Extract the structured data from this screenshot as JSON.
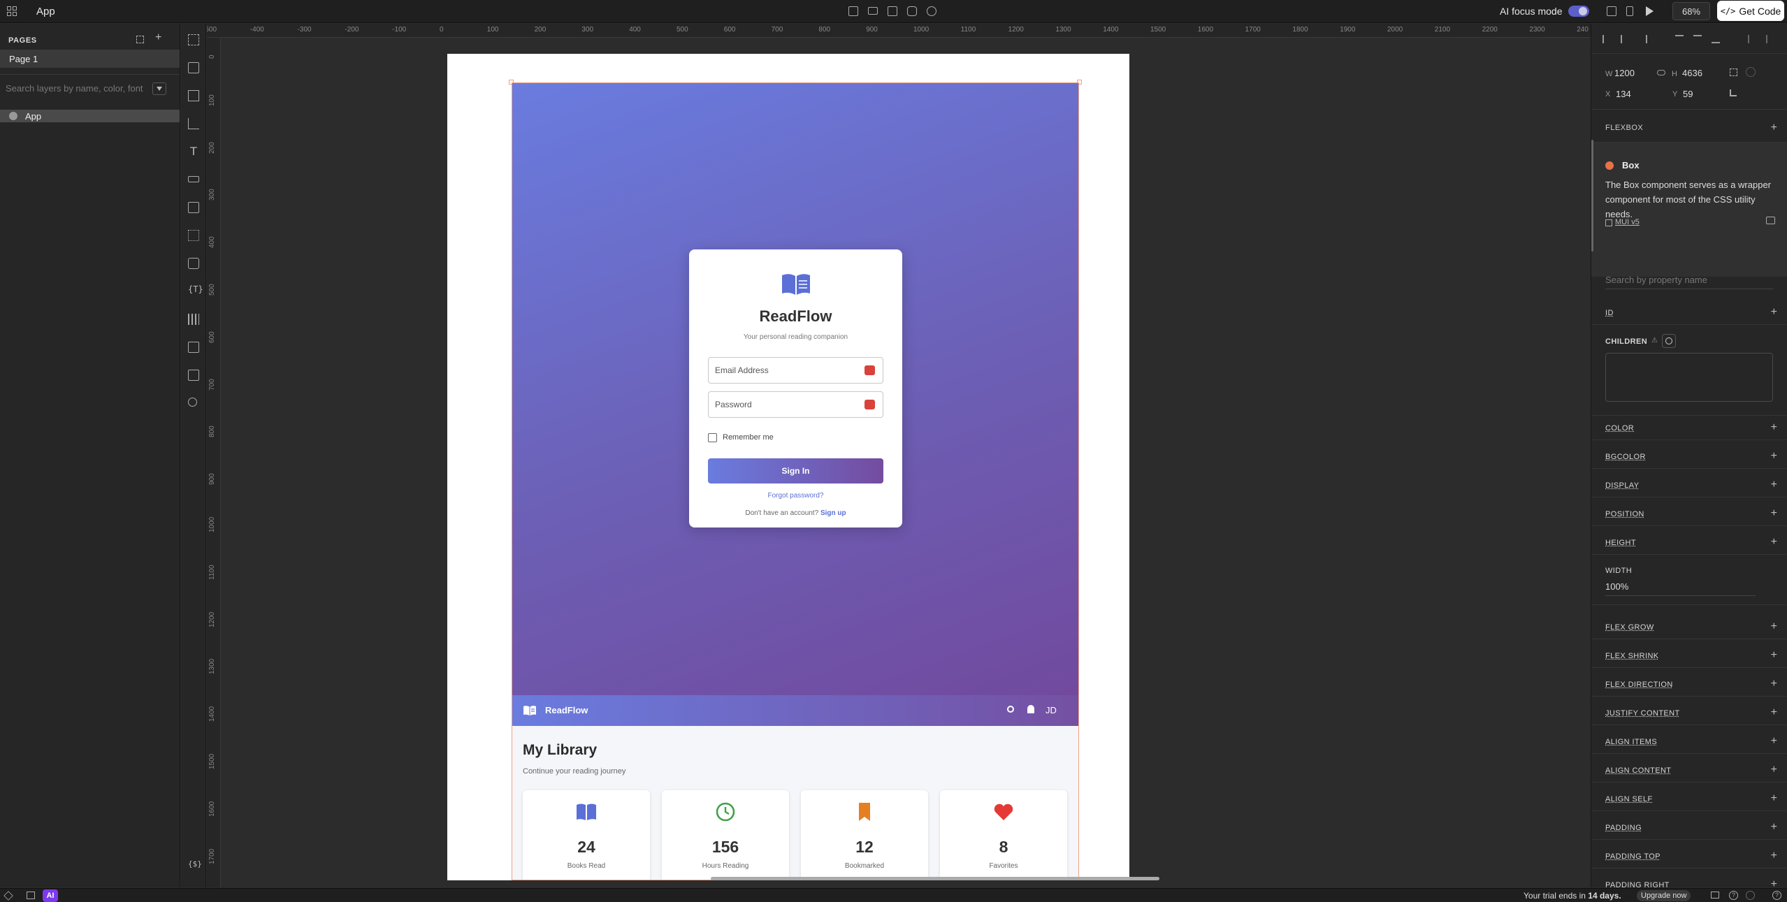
{
  "topbar": {
    "app_name": "App",
    "ai_focus_label": "AI focus mode",
    "zoom": "68%",
    "get_code_label": "Get Code"
  },
  "left_panel": {
    "pages_title": "PAGES",
    "pages": [
      "Page 1"
    ],
    "layer_search_placeholder": "Search layers by name, color, font",
    "layers": [
      "App"
    ]
  },
  "ruler": {
    "top_ticks": [
      "-500",
      "-400",
      "-300",
      "-200",
      "-100",
      "0",
      "100",
      "200",
      "300",
      "400",
      "500",
      "600",
      "700",
      "800",
      "900",
      "1000",
      "1100",
      "1200",
      "1300",
      "1400",
      "1500",
      "1600",
      "1700",
      "1800",
      "1900",
      "2000",
      "2100",
      "2200",
      "2300",
      "240"
    ],
    "left_ticks": [
      "0",
      "100",
      "200",
      "300",
      "400",
      "500",
      "600",
      "700",
      "800",
      "900",
      "1000",
      "1100",
      "1200",
      "1300",
      "1400",
      "1500",
      "1600",
      "1700"
    ]
  },
  "login": {
    "brand": "ReadFlow",
    "tagline": "Your personal reading companion",
    "email_placeholder": "Email Address",
    "password_placeholder": "Password",
    "remember_label": "Remember me",
    "signin_label": "Sign In",
    "forgot_label": "Forgot password?",
    "no_account_label": "Don't have an account?",
    "signup_label": "Sign up"
  },
  "appbar": {
    "brand": "ReadFlow",
    "avatar_initials": "JD"
  },
  "library": {
    "title": "My Library",
    "subtitle": "Continue your reading journey",
    "stats": [
      {
        "value": "24",
        "label": "Books Read",
        "icon": "book-icon",
        "color": "#5b6fd6"
      },
      {
        "value": "156",
        "label": "Hours Reading",
        "icon": "clock-icon",
        "color": "#43a047"
      },
      {
        "value": "12",
        "label": "Bookmarked",
        "icon": "bookmark-icon",
        "color": "#e67e22"
      },
      {
        "value": "8",
        "label": "Favorites",
        "icon": "heart-icon",
        "color": "#e53935"
      }
    ]
  },
  "right_panel": {
    "w_label": "W",
    "w_value": "1200",
    "h_label": "H",
    "h_value": "4636",
    "x_label": "X",
    "x_value": "134",
    "y_label": "Y",
    "y_value": "59",
    "flexbox_label": "FLEXBOX",
    "component_name": "Box",
    "component_description": "The Box component serves as a wrapper component for most of the CSS utility needs.",
    "library_link": "MUI v5",
    "property_search_placeholder": "Search by property name",
    "id_label": "ID",
    "children_label": "CHILDREN",
    "width_label": "WIDTH",
    "width_value": "100%",
    "properties_top": [
      "COLOR",
      "BGCOLOR",
      "DISPLAY",
      "POSITION",
      "HEIGHT"
    ],
    "properties_bottom": [
      "FLEX GROW",
      "FLEX SHRINK",
      "FLEX DIRECTION",
      "JUSTIFY CONTENT",
      "ALIGN ITEMS",
      "ALIGN CONTENT",
      "ALIGN SELF",
      "PADDING",
      "PADDING TOP",
      "PADDING RIGHT"
    ]
  },
  "bottombar": {
    "trial_prefix": "Your trial ends in",
    "trial_days": "14 days.",
    "upgrade_label": "Upgrade now",
    "ai_label": "AI"
  },
  "colors": {
    "accent": "#6a7cdf",
    "accent_end": "#744c9f",
    "toggle": "#5b5fc7"
  }
}
